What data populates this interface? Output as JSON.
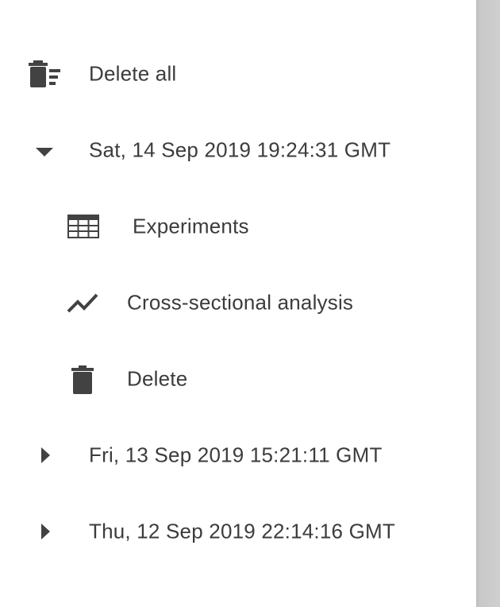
{
  "drawer": {
    "delete_all": {
      "label": "Delete all",
      "icon": "delete-sweep-icon"
    },
    "sessions": [
      {
        "date": "Sat, 14 Sep 2019 19:24:31 GMT",
        "expanded": true,
        "icon": "caret-down-icon",
        "children": [
          {
            "label": "Experiments",
            "icon": "table-icon"
          },
          {
            "label": "Cross-sectional analysis",
            "icon": "trending-line-icon"
          },
          {
            "label": "Delete",
            "icon": "trash-icon"
          }
        ]
      },
      {
        "date": "Fri, 13 Sep 2019 15:21:11 GMT",
        "expanded": false,
        "icon": "caret-right-icon"
      },
      {
        "date": "Thu, 12 Sep 2019 22:14:16 GMT",
        "expanded": false,
        "icon": "caret-right-icon"
      }
    ]
  },
  "colors": {
    "text": "#3c3c3c",
    "icon": "#424242",
    "scrim": "#c8c8c8"
  }
}
